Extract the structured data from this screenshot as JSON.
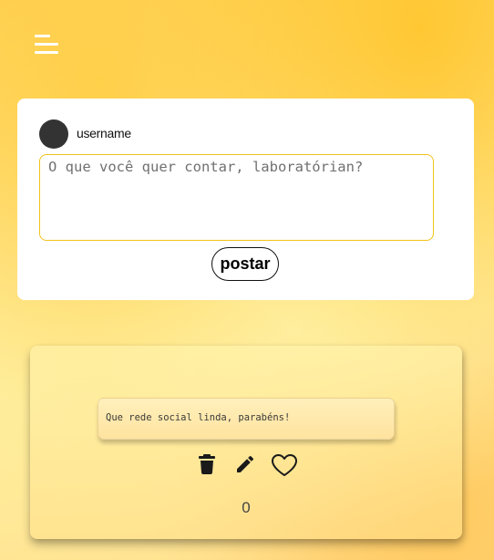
{
  "nav": {
    "menu_icon": "hamburger-menu-icon"
  },
  "composer": {
    "avatar_color": "#333333",
    "username": "username",
    "input_placeholder": "O que você quer contar, laboratórian?",
    "input_value": "",
    "post_button_label": "postar",
    "accent_color": "#f1c21a"
  },
  "post": {
    "text": "Que rede social linda, parabéns!",
    "actions": {
      "delete_icon": "trash-icon",
      "edit_icon": "pencil-icon",
      "like_icon": "heart-outline-icon"
    },
    "like_count": "0"
  }
}
